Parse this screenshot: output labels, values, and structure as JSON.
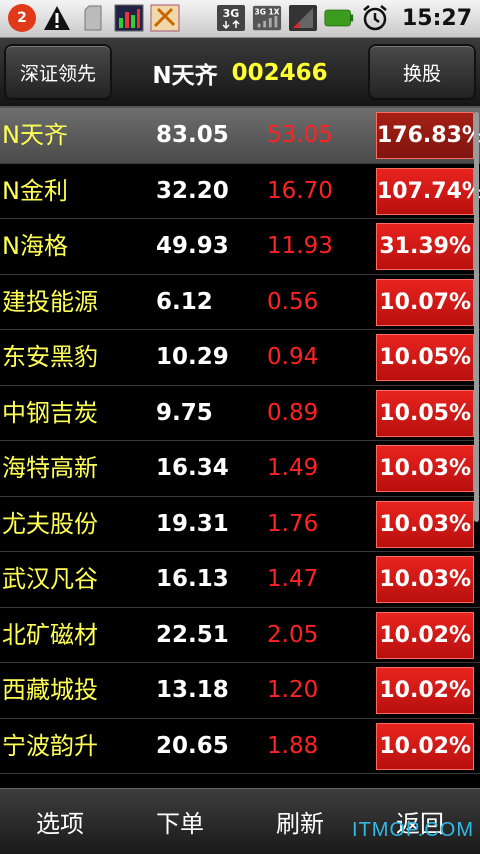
{
  "status_bar": {
    "notification_count": "2",
    "network_type": "3G",
    "network_detail": "3G 1X",
    "time": "15:27"
  },
  "header": {
    "left_button": "深证领先",
    "stock_name": "N天齐",
    "stock_code": "002466",
    "right_button": "换股"
  },
  "rows": [
    {
      "name": "N天齐",
      "price": "83.05",
      "change": "53.05",
      "pct": "176.83%"
    },
    {
      "name": "N金利",
      "price": "32.20",
      "change": "16.70",
      "pct": "107.74%"
    },
    {
      "name": "N海格",
      "price": "49.93",
      "change": "11.93",
      "pct": "31.39%"
    },
    {
      "name": "建投能源",
      "price": "6.12",
      "change": "0.56",
      "pct": "10.07%"
    },
    {
      "name": "东安黑豹",
      "price": "10.29",
      "change": "0.94",
      "pct": "10.05%"
    },
    {
      "name": "中钢吉炭",
      "price": "9.75",
      "change": "0.89",
      "pct": "10.05%"
    },
    {
      "name": "海特高新",
      "price": "16.34",
      "change": "1.49",
      "pct": "10.03%"
    },
    {
      "name": "尤夫股份",
      "price": "19.31",
      "change": "1.76",
      "pct": "10.03%"
    },
    {
      "name": "武汉凡谷",
      "price": "16.13",
      "change": "1.47",
      "pct": "10.03%"
    },
    {
      "name": "北矿磁材",
      "price": "22.51",
      "change": "2.05",
      "pct": "10.02%"
    },
    {
      "name": "西藏城投",
      "price": "13.18",
      "change": "1.20",
      "pct": "10.02%"
    },
    {
      "name": "宁波韵升",
      "price": "20.65",
      "change": "1.88",
      "pct": "10.02%"
    }
  ],
  "bottom_bar": {
    "options": "选项",
    "order": "下单",
    "refresh": "刷新",
    "back": "返回"
  },
  "watermark": "ITMOP.COM",
  "colors": {
    "name_text": "#ffff55",
    "stock_code": "#ffff33",
    "change_text": "#ff2222",
    "pct_bg": "#d81b17"
  }
}
